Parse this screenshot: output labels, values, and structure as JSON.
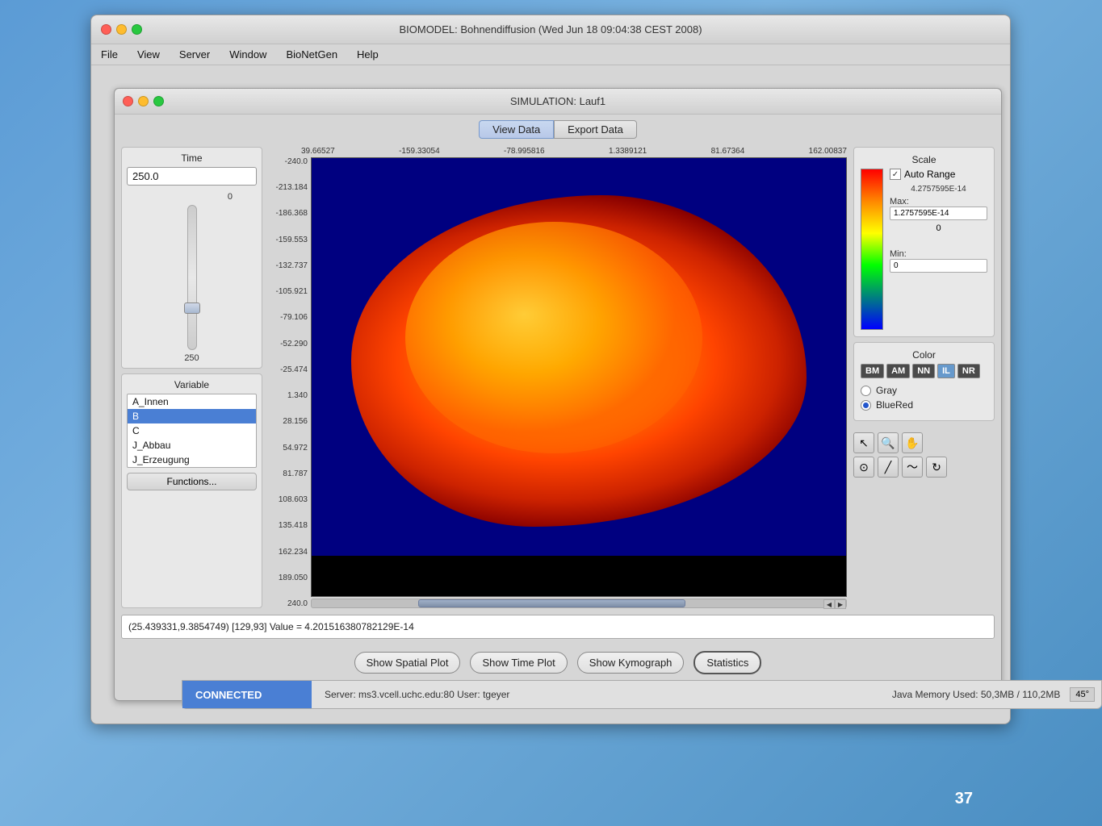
{
  "outerWindow": {
    "title": "BIOMODEL: Bohnendiffusion (Wed Jun 18 09:04:38 CEST 2008)"
  },
  "menubar": {
    "items": [
      "File",
      "View",
      "Server",
      "Window",
      "BioNetGen",
      "Help"
    ]
  },
  "simWindow": {
    "title": "SIMULATION: Lauf1"
  },
  "tabs": {
    "viewData": "View Data",
    "exportData": "Export Data"
  },
  "timePanel": {
    "label": "Time",
    "value": "250.0",
    "sliderMin": "0",
    "sliderMax": "250"
  },
  "variablePanel": {
    "label": "Variable",
    "items": [
      "A_Innen",
      "B",
      "C",
      "J_Abbau",
      "J_Erzeugung"
    ],
    "selected": "B"
  },
  "functionsBtn": "Functions...",
  "axisTopLabels": [
    "39.66527",
    "-159.33054",
    "-78.995816",
    "1.3389121",
    "81.67364",
    "162.00837"
  ],
  "axisYLabels": [
    "-240.0",
    "-213.184",
    "-186.368",
    "-159.553",
    "-132.737",
    "-105.921",
    "-79.106",
    "-52.290",
    "-25.474",
    "1.340",
    "28.156",
    "54.972",
    "81.787",
    "108.603",
    "135.418",
    "162.234",
    "189.050",
    "240.0"
  ],
  "scale": {
    "label": "Scale",
    "autoRangeLabel": "Auto Range",
    "autoRangeChecked": true,
    "scaleValue": "4.2757595E-14",
    "maxLabel": "Max:",
    "maxValue": "1.2757595E-14",
    "minLabel": "Min:",
    "minValue": "0",
    "zeroLabel": "0"
  },
  "color": {
    "label": "Color",
    "buttons": [
      "BM",
      "AM",
      "NN",
      "IL",
      "NR"
    ],
    "grayLabel": "Gray",
    "blueRedLabel": "BlueRed",
    "selected": "BlueRed"
  },
  "tools": {
    "icons": [
      "↖",
      "🔍",
      "✋",
      "⊙",
      "╱",
      "〜",
      "⟳"
    ]
  },
  "coordBar": {
    "text": "(25.439331,9.3854749) [129,93] Value = 4.2015163807821​29E-14"
  },
  "bottomButtons": {
    "showSpatialPlot": "Show Spatial Plot",
    "showTimePlot": "Show Time Plot",
    "showKymograph": "Show Kymograph",
    "statistics": "Statistics"
  },
  "statusBar": {
    "connected": "CONNECTED",
    "serverInfo": "Server: ms3.vcell.uchc.edu:80 User: tgeyer",
    "memoryInfo": "Java Memory Used: 50,3MB / 110,2MB",
    "angleBadge": "45°"
  },
  "slideNumber": "37"
}
